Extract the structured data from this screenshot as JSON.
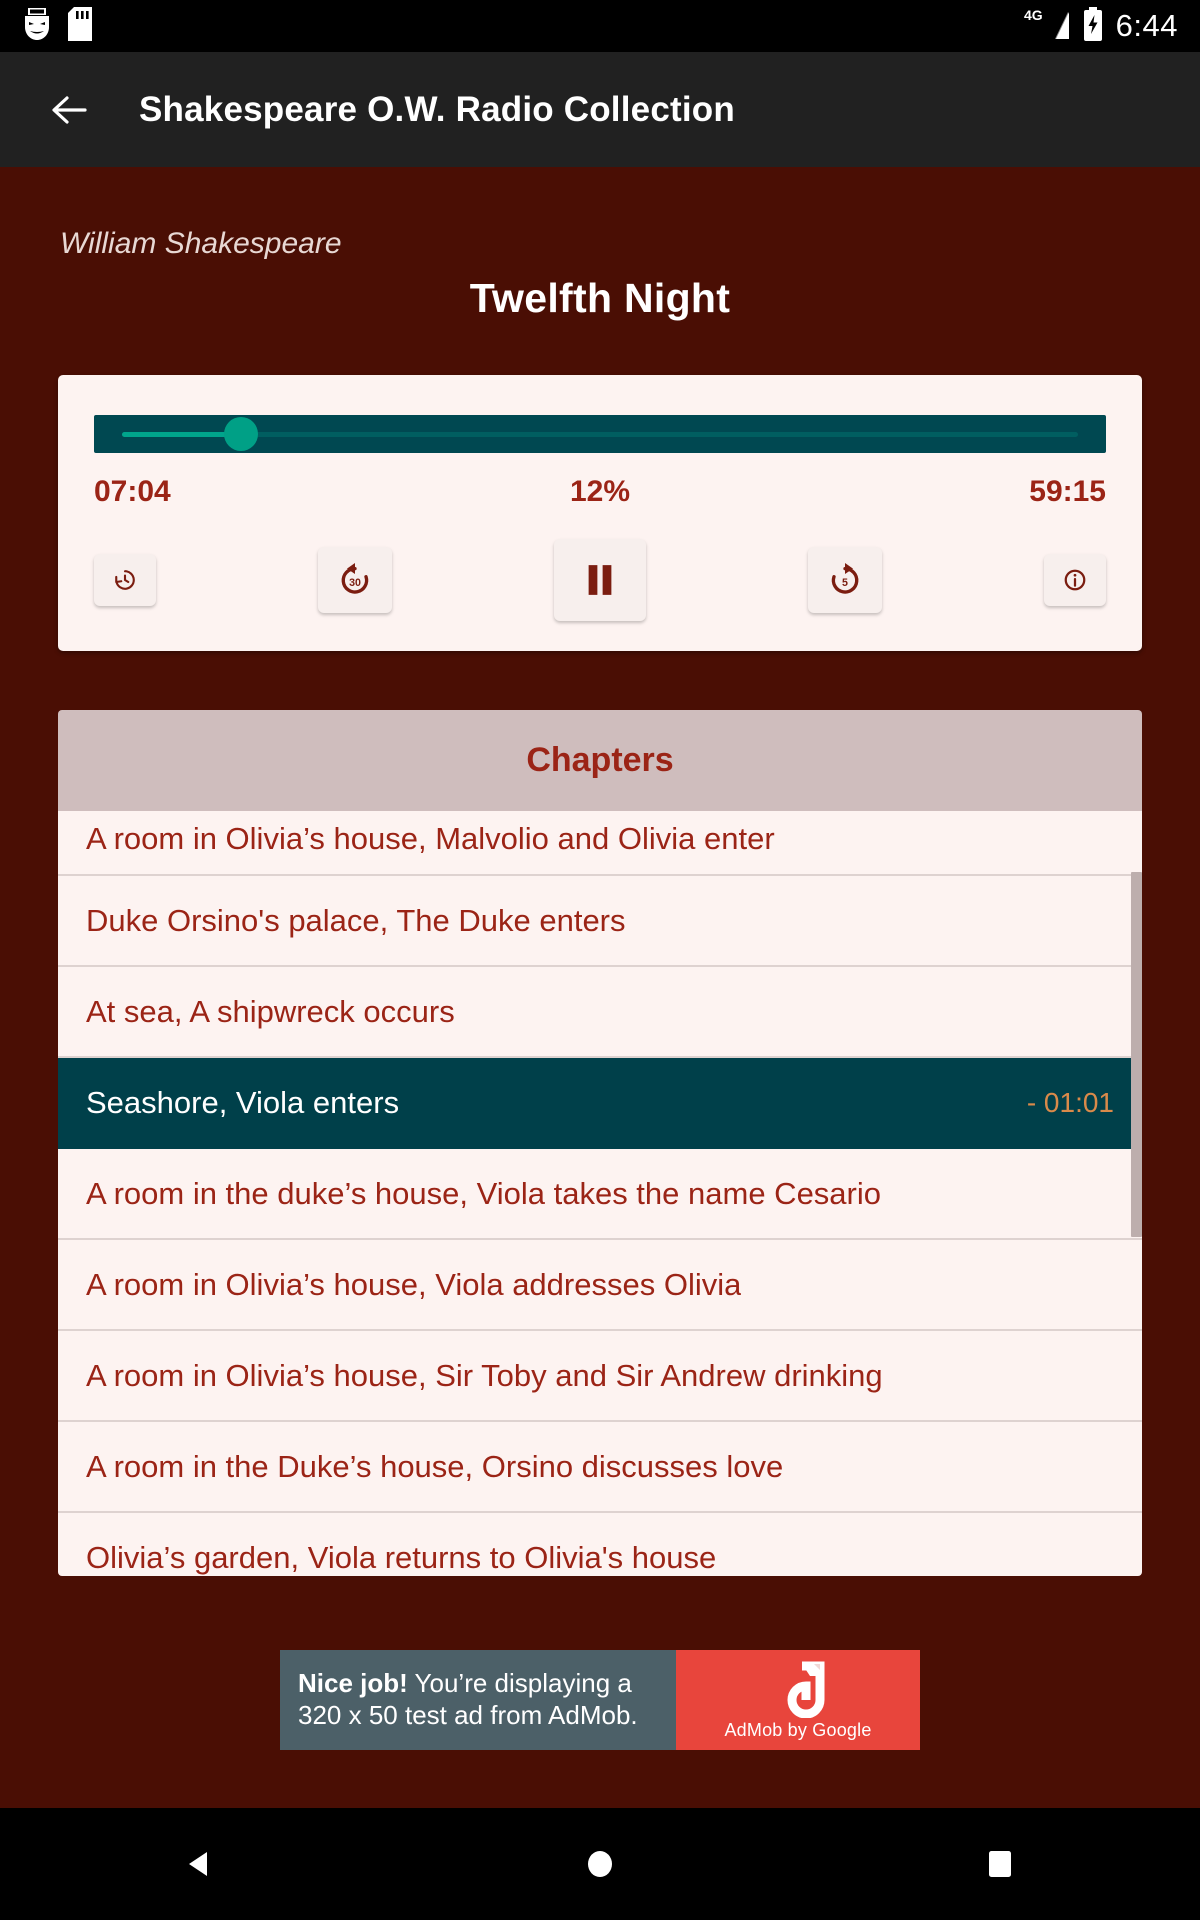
{
  "statusbar": {
    "icons": [
      "drama-mask-icon",
      "sd-card-icon"
    ],
    "network": "4G",
    "battery": "battery-charging-icon",
    "time": "6:44"
  },
  "appbar": {
    "back_label": "back-arrow",
    "title": "Shakespeare O.W. Radio Collection"
  },
  "header": {
    "author": "William Shakespeare",
    "title": "Twelfth Night"
  },
  "player": {
    "progress_percent": 12,
    "elapsed": "07:04",
    "percent_label": "12%",
    "total": "59:15",
    "controls": [
      {
        "name": "restore-position-button",
        "icon": "history-restore-icon"
      },
      {
        "name": "rewind-30-button",
        "icon": "replay-30-icon",
        "value": "30"
      },
      {
        "name": "play-pause-button",
        "icon": "pause-icon",
        "state": "playing"
      },
      {
        "name": "forward-5-button",
        "icon": "forward-5-icon",
        "value": "5"
      },
      {
        "name": "info-button",
        "icon": "info-circle-icon"
      }
    ],
    "colors": {
      "track": "#004851",
      "fill": "#00a58c",
      "accent": "#9b2416",
      "card": "#fdf3f1"
    }
  },
  "chapters": {
    "header": "Chapters",
    "selected_index": 3,
    "items": [
      {
        "label": "A room in Olivia’s house, Malvolio and Olivia enter",
        "remaining": ""
      },
      {
        "label": "Duke Orsino's palace, The Duke enters",
        "remaining": ""
      },
      {
        "label": "At sea, A shipwreck occurs",
        "remaining": ""
      },
      {
        "label": "Seashore, Viola enters",
        "remaining": "- 01:01"
      },
      {
        "label": "A room in the duke’s house, Viola takes the name Cesario",
        "remaining": ""
      },
      {
        "label": "A room in Olivia’s house, Viola addresses Olivia",
        "remaining": ""
      },
      {
        "label": "A room in Olivia’s house, Sir Toby and Sir Andrew drinking",
        "remaining": ""
      },
      {
        "label": "A room in the Duke’s house, Orsino discusses love",
        "remaining": ""
      },
      {
        "label": "Olivia’s garden, Viola returns to Olivia's house",
        "remaining": ""
      }
    ]
  },
  "ad": {
    "headline": "Nice job!",
    "body": " You’re displaying a 320 x 50 test ad from AdMob.",
    "logo_caption": "AdMob by Google"
  },
  "navbar": {
    "back": "nav-back-triangle",
    "home": "nav-home-circle",
    "recents": "nav-recents-square"
  }
}
